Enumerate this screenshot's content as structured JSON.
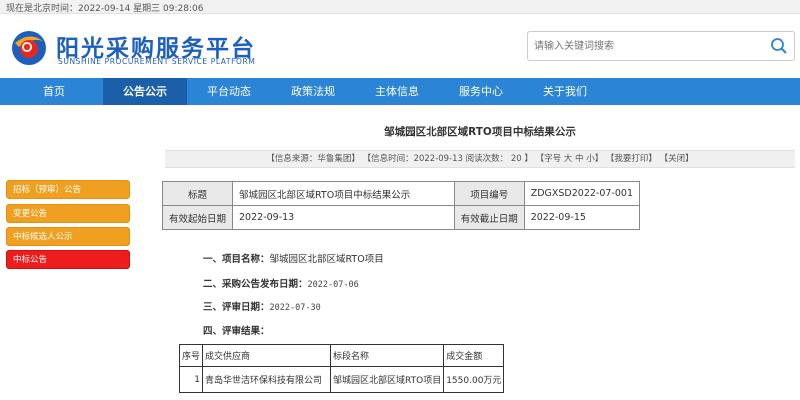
{
  "topbar": {
    "text": "现在是北京时间：2022-09-14  星期三  09:28:06"
  },
  "brand": {
    "name_cn": "阳光采购服务平台",
    "name_en": "SUNSHINE PROCUREMENT SERVICE PLATFORM",
    "color": "#1d5fbf"
  },
  "search": {
    "placeholder": "请输入关键词搜索",
    "icon": "search-icon"
  },
  "nav": {
    "items": [
      "首页",
      "公告公示",
      "平台动态",
      "政策法规",
      "主体信息",
      "服务中心",
      "关于我们"
    ],
    "active": "公告公示",
    "color": "#2b84d6",
    "active_color": "#1a5fa8"
  },
  "sidebar": {
    "items": [
      "招标（预审）公告",
      "变更公告",
      "中标候选人公示",
      "中标公告"
    ],
    "active": "中标公告",
    "color": "#f0a020",
    "active_color": "#ee1c1c"
  },
  "article": {
    "title": "邹城园区北部区域RTO项目中标结果公示",
    "info": {
      "source": "【信息来源：华鲁集团】",
      "date": "【信息时间：2022-09-13  阅读次数： 20 】",
      "font_size": "【字号 大 中 小】",
      "print": "【我要打印】",
      "close": "【关闭】"
    }
  },
  "meta": {
    "title_label": "标题",
    "title_value": "邹城园区北部区域RTO项目中标结果公示",
    "code_label": "项目编号",
    "code_value": "ZDGXSD2022-07-001",
    "start_label": "有效起始日期",
    "start_value": "2022-09-13",
    "end_label": "有效截止日期",
    "end_value": "2022-09-15"
  },
  "sections": {
    "project_label": "一、项目名称：",
    "project_value": "邹城园区北部区域RTO项目",
    "publish_label": "二、采购公告发布日期：",
    "publish_value": "2022-07-06",
    "review_label": "三、评审日期：",
    "review_value": "2022-07-30",
    "result_label": "四、评审结果："
  },
  "result_table": {
    "headers": [
      "序号",
      "成交供应商",
      "标段名称",
      "成交金额"
    ],
    "rows": [
      [
        "1",
        "青岛华世洁环保科技有限公司",
        "邹城园区北部区域RTO项目",
        "1550.00万元"
      ]
    ]
  }
}
